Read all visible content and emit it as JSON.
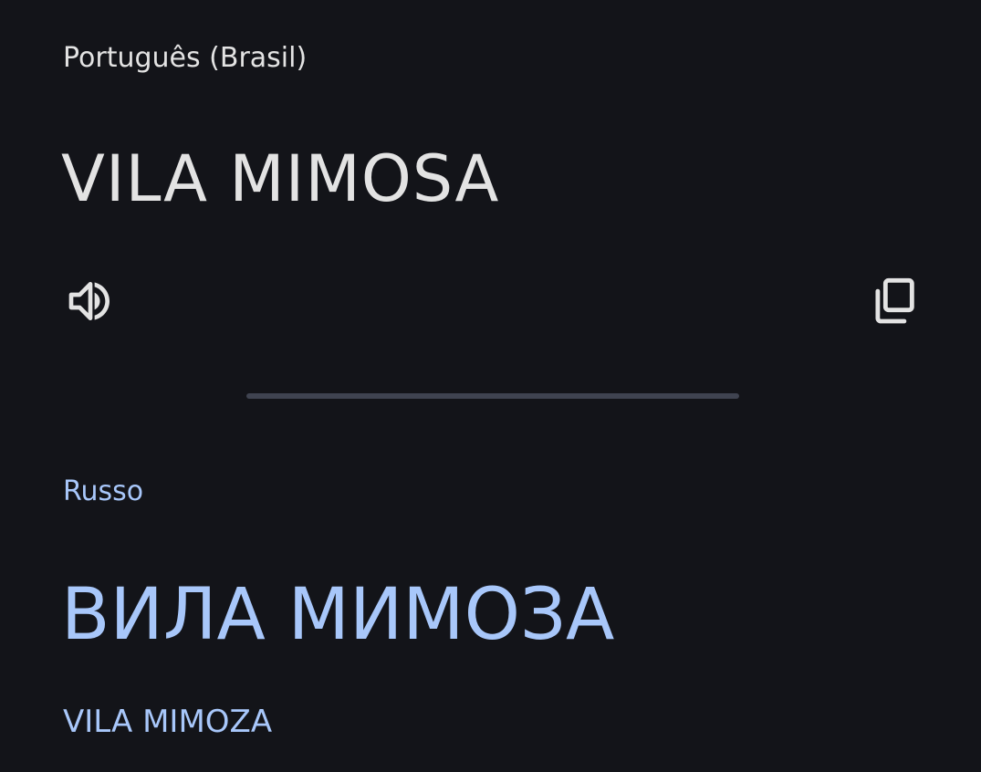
{
  "source": {
    "language": "Português (Brasil)",
    "text": "VILA MIMOSA",
    "listen_icon": "speaker-icon",
    "copy_icon": "copy-icon"
  },
  "target": {
    "language": "Russo",
    "text": "ВИЛА МИМОЗА",
    "transliteration": "VILA MIMOZA"
  },
  "colors": {
    "background": "#131419",
    "primary_text": "#e3e3e3",
    "accent_text": "#a8c7fa",
    "divider": "#3f4350"
  }
}
